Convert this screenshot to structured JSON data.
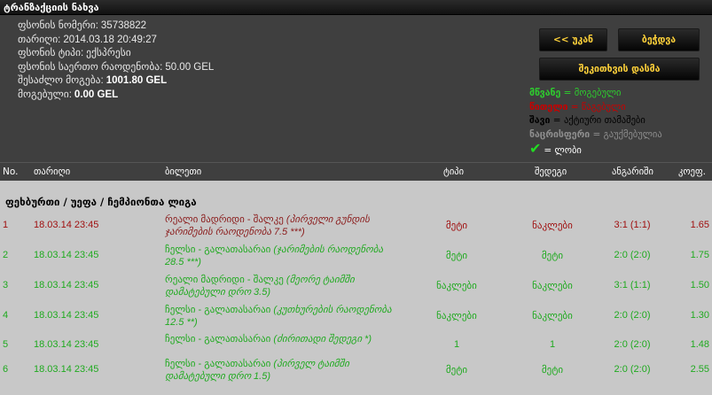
{
  "title": "ტრანზაქციის ნახვა",
  "info": {
    "ticket_no_label": "ფსონის ნომერი:",
    "ticket_no": "35738822",
    "date_label": "თარიღი:",
    "date": "2014.03.18 20:49:27",
    "type_label": "ფსონის ტიპი:",
    "type": "ექსპრესი",
    "amount_label": "ფსონის საერთო რაოდენობა:",
    "amount": "50.00 GEL",
    "possible_win_label": "შესაძლო მოგება:",
    "possible_win": "1001.80 GEL",
    "win_label": "მოგებული:",
    "win": "0.00 GEL"
  },
  "buttons": {
    "back": "<< უკან",
    "print": "ბეჭდვა",
    "save": "შეკითხვის დასმა"
  },
  "legend": {
    "green_word": "მწვანე",
    "green_text": " = მოგებული",
    "red_word": "წითელი",
    "red_text": " = წაგებული",
    "black_word": "შავი",
    "black_text": " = აქტიური თამაშები",
    "gray_word": "ნაცრისფერი",
    "gray_text": " = გაუქმებულია",
    "check_text": "= ლობი"
  },
  "columns": {
    "no": "No.",
    "date": "თარიღი",
    "bet": "ბილეთი",
    "type": "ტიპი",
    "result": "შედეგი",
    "score": "ანგარიში",
    "odd": "კოეფ."
  },
  "group": "ფეხბურთი / უეფა / ჩემპიონთა ლიგა",
  "rows": [
    {
      "no": "1",
      "date": "18.03.14 23:45",
      "match": "რეალი მადრიდი - შალკე",
      "bet": "(პირველი გუნდის ჯარიმების რაოდენობა 7.5 ***)",
      "type": "მეტი",
      "result": "ნაკლები",
      "score": "3:1 (1:1)",
      "odd": "1.65",
      "status": "red"
    },
    {
      "no": "2",
      "date": "18.03.14 23:45",
      "match": "ჩელსი - გალათასარაი",
      "bet": "(ჯარიმების რაოდენობა 28.5 ***)",
      "type": "მეტი",
      "result": "მეტი",
      "score": "2:0 (2:0)",
      "odd": "1.75",
      "status": "green"
    },
    {
      "no": "3",
      "date": "18.03.14 23:45",
      "match": "რეალი მადრიდი - შალკე",
      "bet": "(მეორე ტაიმში დამატებული დრო 3.5)",
      "type": "ნაკლები",
      "result": "ნაკლები",
      "score": "3:1 (1:1)",
      "odd": "1.50",
      "status": "green"
    },
    {
      "no": "4",
      "date": "18.03.14 23:45",
      "match": "ჩელსი - გალათასარაი",
      "bet": "(კუთხურების რაოდენობა 12.5 **)",
      "type": "ნაკლები",
      "result": "ნაკლები",
      "score": "2:0 (2:0)",
      "odd": "1.30",
      "status": "green"
    },
    {
      "no": "5",
      "date": "18.03.14 23:45",
      "match": "ჩელსი - გალათასარაი",
      "bet": "(ძირითადი შედეგი *)",
      "type": "1",
      "result": "1",
      "score": "2:0 (2:0)",
      "odd": "1.48",
      "status": "green"
    },
    {
      "no": "6",
      "date": "18.03.14 23:45",
      "match": "ჩელსი - გალათასარაი",
      "bet": "(პირველ ტაიმში დამატებული დრო 1.5)",
      "type": "მეტი",
      "result": "მეტი",
      "score": "2:0 (2:0)",
      "odd": "2.55",
      "status": "green"
    }
  ]
}
